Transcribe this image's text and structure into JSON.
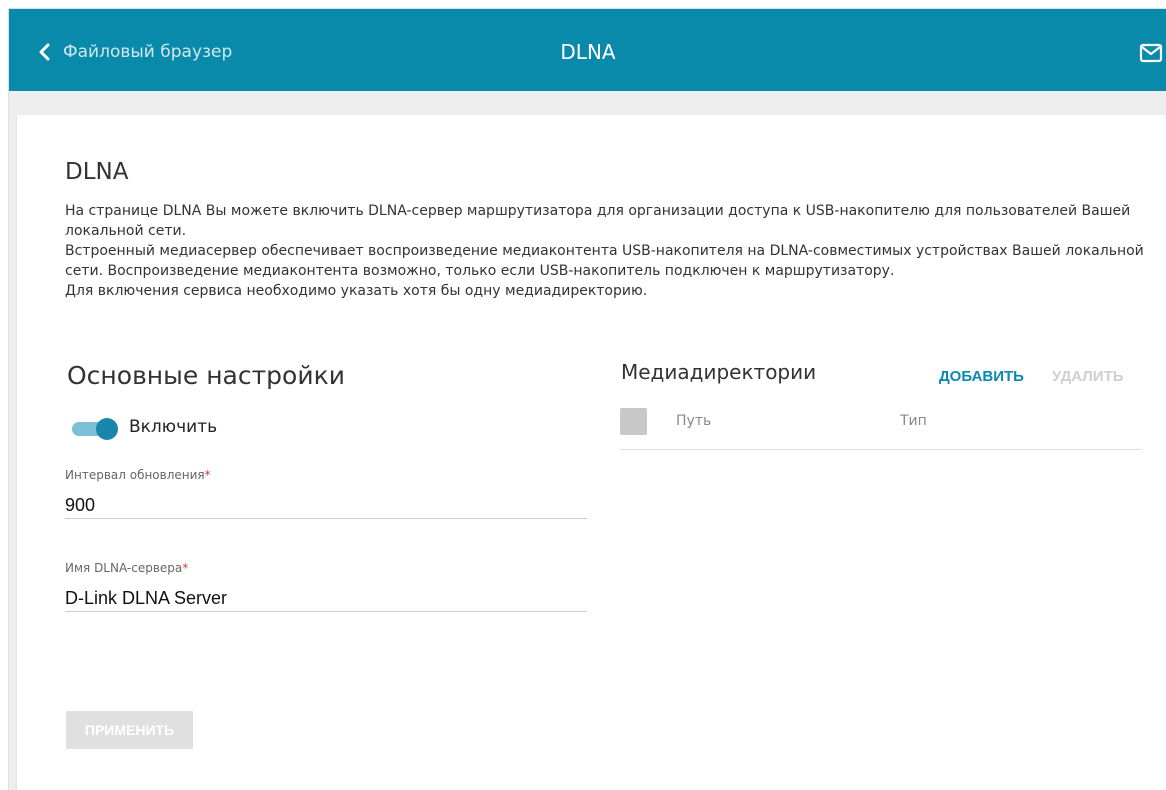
{
  "header": {
    "back_label": "Файловый браузер",
    "title": "DLNA",
    "icons": {
      "back": "chevron-left-icon",
      "mail": "mail-icon"
    }
  },
  "section": {
    "title": "DLNA",
    "description": [
      "На странице DLNA Вы можете включить DLNA-сервер маршрутизатора для организации доступа к USB-накопителю для пользователей Вашей локальной сети.",
      "Встроенный медиасервер обеспечивает воспроизведение медиаконтента USB-накопителя на DLNA-совместимых устройствах Вашей локальной сети. Воспроизведение медиаконтента возможно, только если USB-накопитель подключен к маршрутизатору.",
      "Для включения сервиса необходимо указать хотя бы одну медиадиректорию."
    ]
  },
  "settings": {
    "title": "Основные настройки",
    "enable_label": "Включить",
    "enabled": true,
    "interval": {
      "label": "Интервал обновления",
      "required_mark": "*",
      "value": "900"
    },
    "server_name": {
      "label": "Имя DLNA-сервера",
      "required_mark": "*",
      "value": "D-Link DLNA Server"
    },
    "apply_label": "ПРИМЕНИТЬ"
  },
  "media": {
    "title": "Медиадиректории",
    "add_label": "ДОБАВИТЬ",
    "delete_label": "УДАЛИТЬ",
    "columns": [
      "Путь",
      "Тип"
    ],
    "rows": []
  },
  "colors": {
    "header_bg": "#0a8aab",
    "accent": "#0a88ae",
    "toggle_thumb": "#1987ad",
    "required": "#e53935",
    "disabled": "#e0e0e0"
  }
}
